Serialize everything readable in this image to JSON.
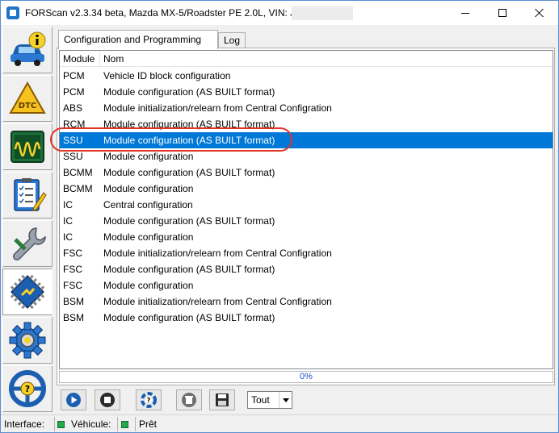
{
  "window": {
    "title": "FORScan v2.3.34 beta, Mazda MX-5/Roadster PE 2.0L, VIN: JMZ"
  },
  "sidebar": {
    "items": [
      {
        "name": "vehicle-info",
        "icon": "car-info-icon"
      },
      {
        "name": "dtc",
        "icon": "dtc-warning-icon"
      },
      {
        "name": "oscilloscope",
        "icon": "oscilloscope-icon"
      },
      {
        "name": "tests",
        "icon": "checklist-icon"
      },
      {
        "name": "service",
        "icon": "wrench-icon"
      },
      {
        "name": "configuration",
        "icon": "chip-config-icon",
        "active": true
      },
      {
        "name": "settings",
        "icon": "gear-icon"
      },
      {
        "name": "help",
        "icon": "steering-help-icon"
      }
    ]
  },
  "tabs": [
    {
      "label": "Configuration and Programming",
      "active": true
    },
    {
      "label": "Log",
      "active": false
    }
  ],
  "table": {
    "headers": {
      "module": "Module",
      "nom": "Nom"
    },
    "rows": [
      {
        "module": "PCM",
        "nom": "Vehicle ID block configuration"
      },
      {
        "module": "PCM",
        "nom": "Module configuration (AS BUILT format)"
      },
      {
        "module": "ABS",
        "nom": "Module initialization/relearn from Central Configration"
      },
      {
        "module": "RCM",
        "nom": "Module configuration (AS BUILT format)"
      },
      {
        "module": "SSU",
        "nom": "Module configuration (AS BUILT format)",
        "selected": true
      },
      {
        "module": "SSU",
        "nom": "Module configuration"
      },
      {
        "module": "BCMM",
        "nom": "Module configuration (AS BUILT format)"
      },
      {
        "module": "BCMM",
        "nom": "Module configuration"
      },
      {
        "module": "IC",
        "nom": "Central configuration"
      },
      {
        "module": "IC",
        "nom": "Module configuration (AS BUILT format)"
      },
      {
        "module": "IC",
        "nom": "Module configuration"
      },
      {
        "module": "FSC",
        "nom": "Module initialization/relearn from Central Configration"
      },
      {
        "module": "FSC",
        "nom": "Module configuration (AS BUILT format)"
      },
      {
        "module": "FSC",
        "nom": "Module configuration"
      },
      {
        "module": "BSM",
        "nom": "Module initialization/relearn from Central Configration"
      },
      {
        "module": "BSM",
        "nom": "Module configuration (AS BUILT format)"
      }
    ]
  },
  "progress": {
    "text": "0%",
    "value": 0
  },
  "toolbar": {
    "buttons": [
      {
        "name": "run",
        "icon": "play-icon"
      },
      {
        "name": "stop",
        "icon": "stop-icon"
      },
      {
        "name": "help",
        "icon": "help-lifebuoy-icon"
      },
      {
        "name": "delete",
        "icon": "trash-icon"
      },
      {
        "name": "save",
        "icon": "save-icon"
      }
    ],
    "filter_value": "Tout"
  },
  "statusbar": {
    "interface_label": "Interface:",
    "vehicle_label": "Véhicule:",
    "status_text": "Prêt",
    "led_color": "#23a94a"
  },
  "colors": {
    "selection": "#0078d7",
    "highlight_oval": "#e0352a",
    "progress_text": "#1a50c8"
  }
}
